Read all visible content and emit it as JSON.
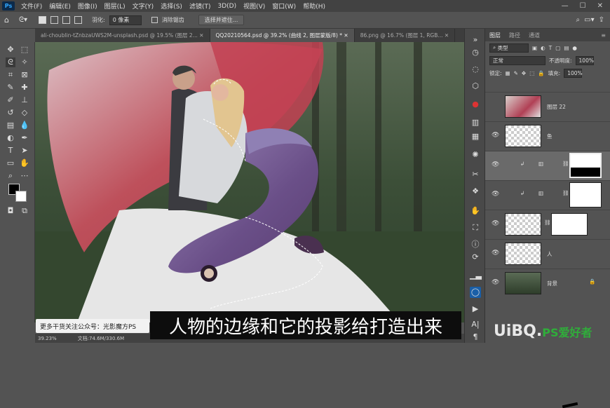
{
  "menubar": {
    "app_icon": "Ps",
    "items": [
      "文件(F)",
      "编辑(E)",
      "图像(I)",
      "图层(L)",
      "文字(Y)",
      "选择(S)",
      "滤镜(T)",
      "3D(D)",
      "视图(V)",
      "窗口(W)",
      "帮助(H)"
    ]
  },
  "options": {
    "feather_label": "羽化:",
    "feather_value": "0 像素",
    "antialias_label": "消除锯齿",
    "select_mask_button": "选择并遮住..."
  },
  "tabs": [
    {
      "label": "ali-choublin-tZnbzaUWS2M-unsplash.psd @ 19.5% (图层 2...",
      "active": false
    },
    {
      "label": "QQ20210564.psd @ 39.2% (曲线 2, 图层蒙版/8) *",
      "active": true
    },
    {
      "label": "86.png @ 16.7% (图层 1, RGB...",
      "active": false
    }
  ],
  "status": {
    "zoom": "39.23%",
    "doc": "文档:74.6M/330.6M"
  },
  "layers_panel": {
    "tabs": [
      "图层",
      "路径",
      "通道"
    ],
    "filter_label": "类型",
    "blend_mode": "正常",
    "opacity_label": "不透明度:",
    "opacity_value": "100%",
    "lock_label": "锁定:",
    "fill_label": "填充:",
    "fill_value": "100%",
    "layers": [
      {
        "name": "图层 22",
        "visible": false
      },
      {
        "name": "鱼",
        "visible": true
      },
      {
        "name": "",
        "visible": true
      },
      {
        "name": "",
        "visible": true
      },
      {
        "name": "",
        "visible": true
      },
      {
        "name": "人",
        "visible": true
      },
      {
        "name": "背景",
        "visible": true
      }
    ]
  },
  "overlays": {
    "subtitle": "人物的边缘和它的投影给打造出来",
    "promo": "更多干货关注公众号：光影魔方PS",
    "watermark_a": "UiBQ.",
    "watermark_b": "PS爱好者"
  },
  "colors": {
    "accent": "#31a8ff",
    "panel": "#535353",
    "bar": "#424242"
  }
}
